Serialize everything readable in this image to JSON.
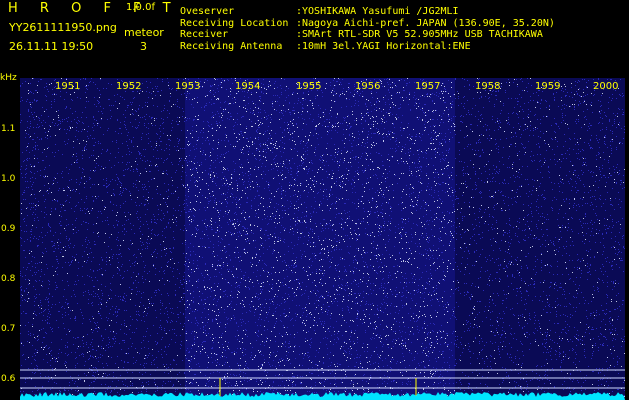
{
  "header": {
    "brand": "H R O F F T",
    "version": "1.0.0f",
    "file_name": "YY2611111950.png",
    "mode": "meteor",
    "timestamp": "26.11.11 19:50",
    "count": "3"
  },
  "info": [
    {
      "label": "Oveserver",
      "value": ":YOSHIKAWA Yasufumi /JG2MLI"
    },
    {
      "label": "Receiving Location",
      "value": ":Nagoya Aichi-pref. JAPAN (136.90E, 35.20N)"
    },
    {
      "label": "Receiver",
      "value": ":SMArt RTL-SDR V5 52.905MHz USB TACHIKAWA"
    },
    {
      "label": "Receiving Antenna",
      "value": ":10mH 3el.YAGI Horizontal:ENE"
    }
  ],
  "axis": {
    "unit": "kHz",
    "y_labels": [
      "1.1",
      "1.0",
      "0.9",
      "0.8",
      "0.7",
      "0.6"
    ],
    "x_labels": [
      "1951",
      "1952",
      "1953",
      "1954",
      "1955",
      "1956",
      "1957",
      "1958",
      "1959",
      "2000"
    ]
  },
  "colors": {
    "text": "#ffff00",
    "background": "#000000",
    "noise": "#2a2ab8",
    "spark": "#e8f0ff",
    "spectrum": "#00e5ff"
  }
}
